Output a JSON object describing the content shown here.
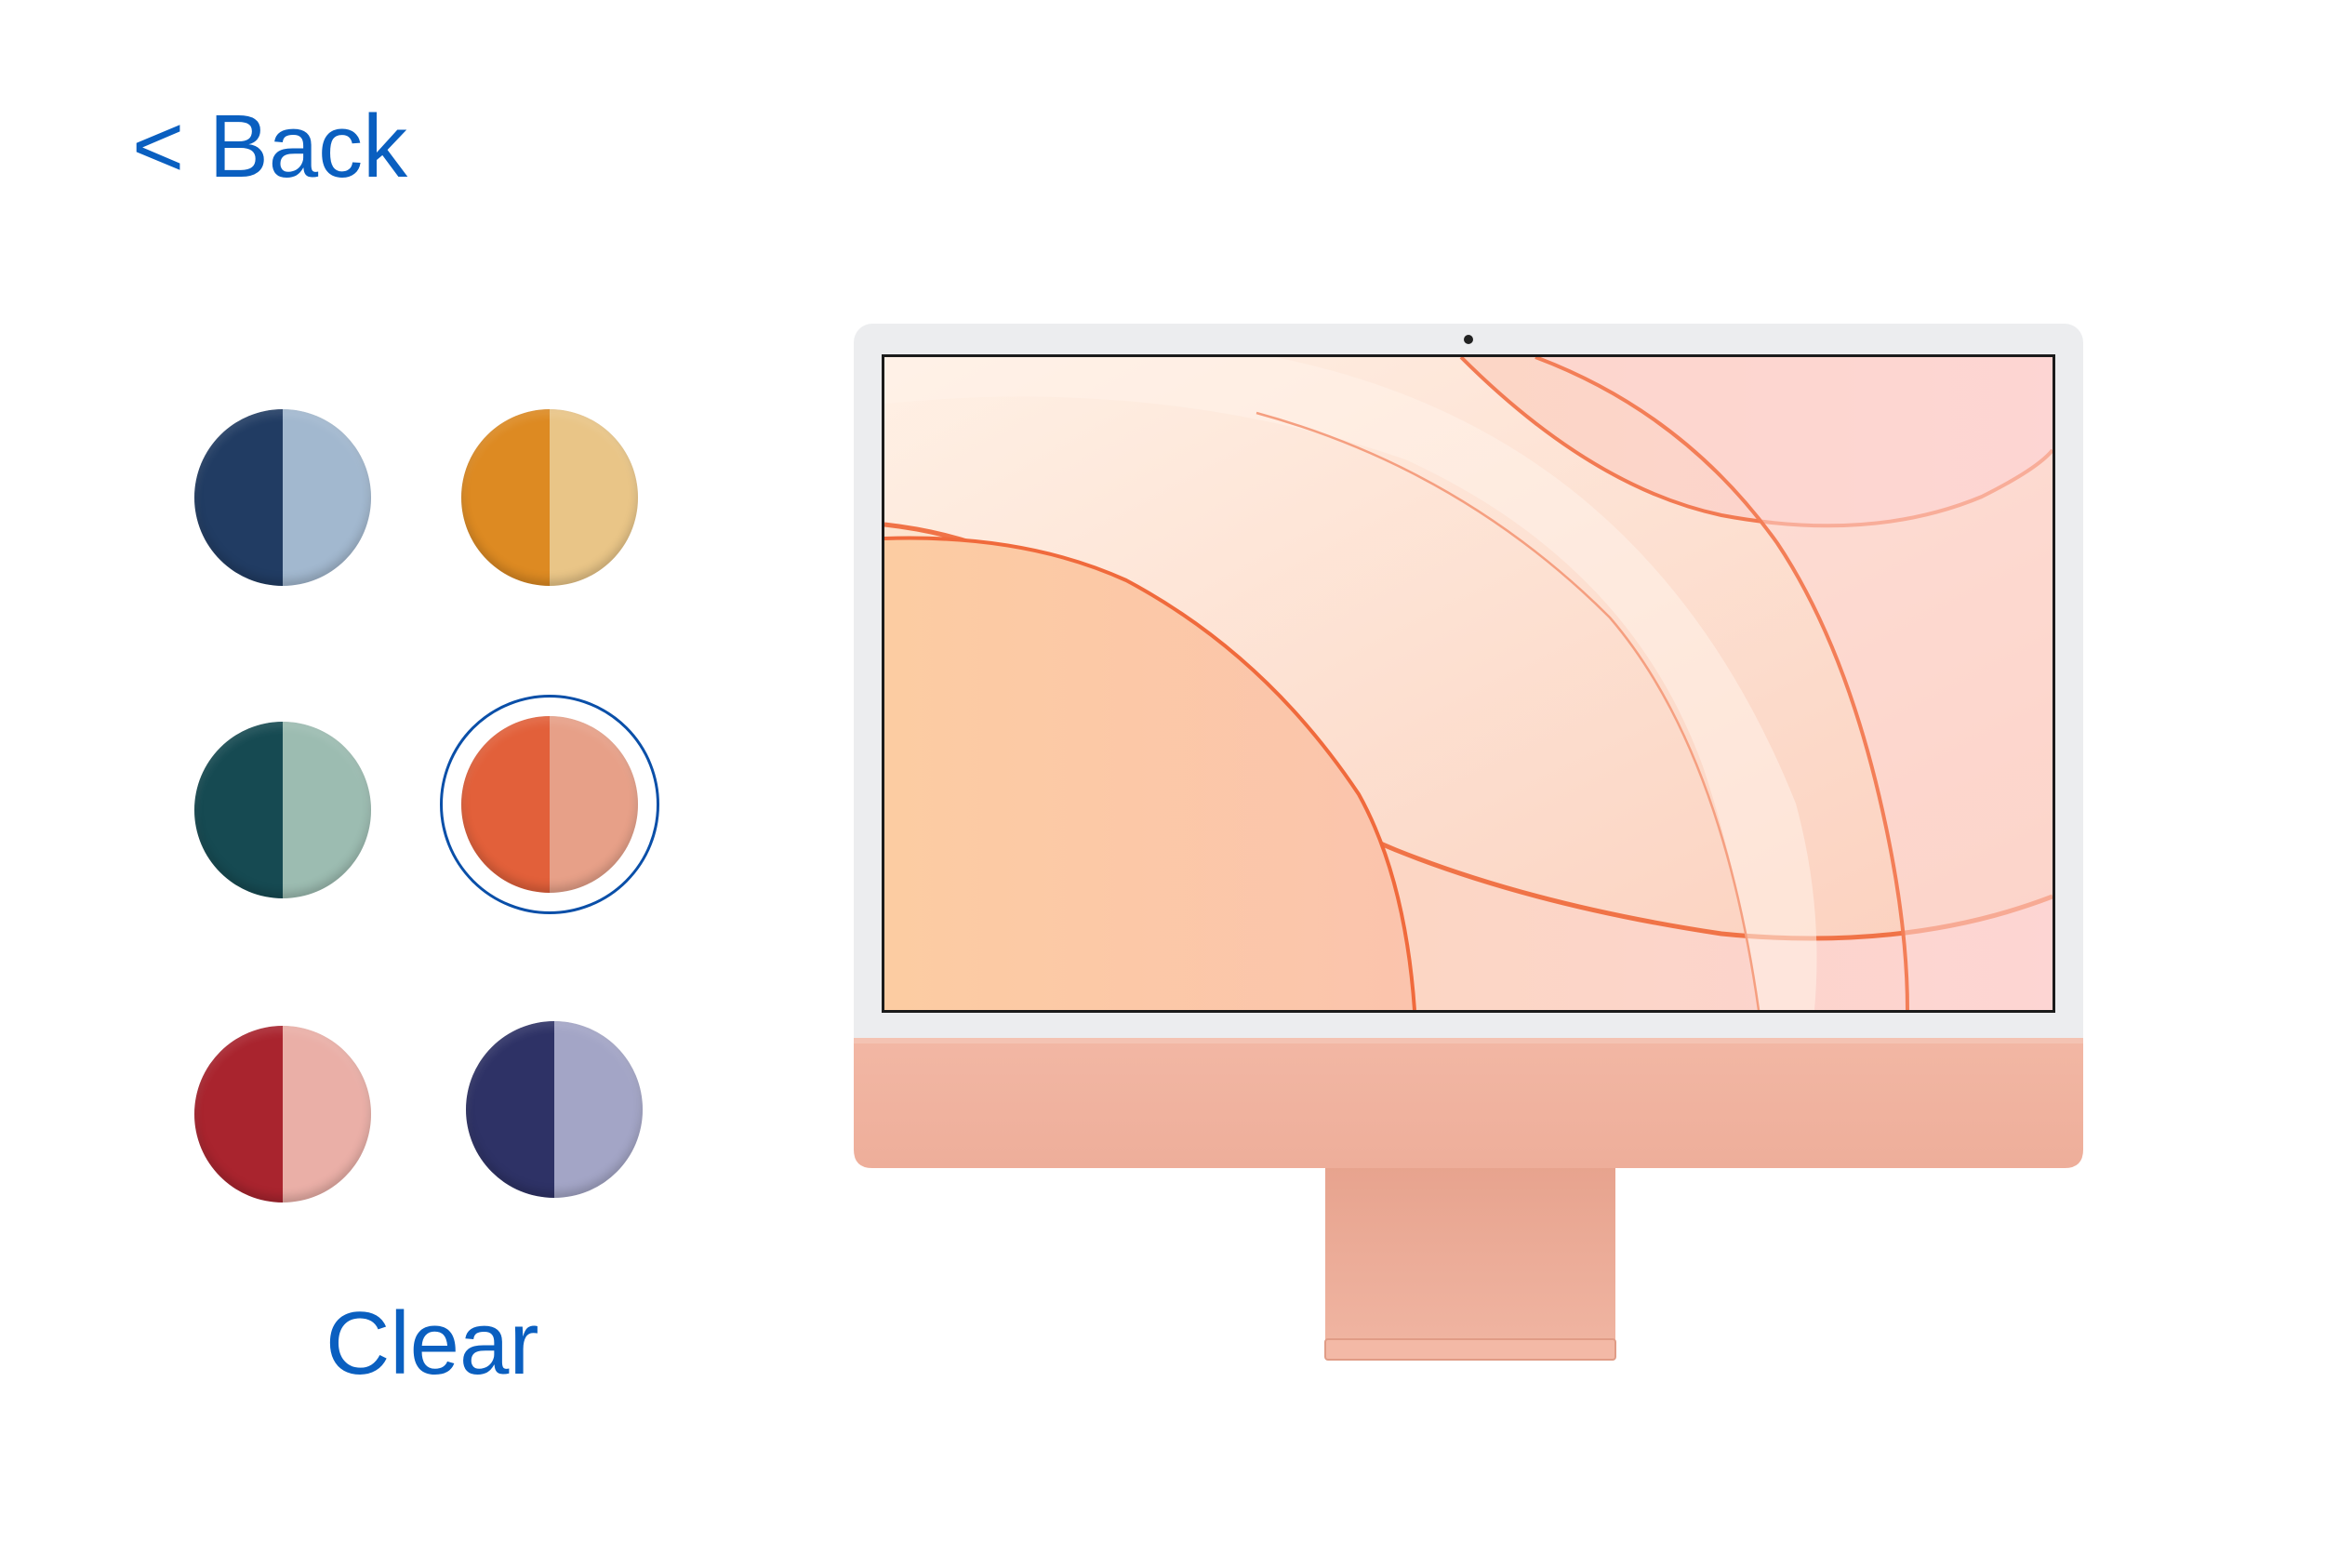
{
  "nav": {
    "back_label": "< Back"
  },
  "swatches": [
    {
      "name": "blue",
      "dark": "#213c63",
      "light": "#a2b8cf",
      "selected": false
    },
    {
      "name": "yellow",
      "dark": "#dd8a22",
      "light": "#e9c587",
      "selected": false
    },
    {
      "name": "green",
      "dark": "#164a52",
      "light": "#9cbcb1",
      "selected": false
    },
    {
      "name": "orange",
      "dark": "#e2603a",
      "light": "#e7a088",
      "selected": true
    },
    {
      "name": "red",
      "dark": "#a9242e",
      "light": "#eaafa7",
      "selected": false
    },
    {
      "name": "purple",
      "dark": "#2e3266",
      "light": "#a3a5c6",
      "selected": false
    }
  ],
  "actions": {
    "clear_label": "Clear"
  },
  "device": {
    "icon": "imac-illustration",
    "body_color": "#f1b4a1",
    "bezel_color": "#ecedef",
    "stand_color": "#e9ab98"
  },
  "colors": {
    "link": "#0a5fc0",
    "selection_ring": "#0a4fa8"
  }
}
